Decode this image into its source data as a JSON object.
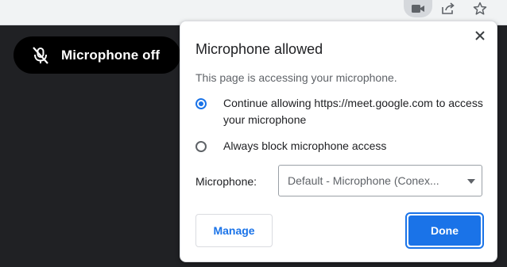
{
  "toolbar": {
    "icons": [
      "video-camera-icon",
      "share-icon",
      "star-icon"
    ]
  },
  "meeting": {
    "mic_status": "Microphone off",
    "mic_icon": "microphone-off-icon"
  },
  "dialog": {
    "title": "Microphone allowed",
    "subtitle": "This page is accessing your microphone.",
    "options": [
      {
        "label": "Continue allowing https://meet.google.com to access your microphone",
        "selected": true
      },
      {
        "label": "Always block microphone access",
        "selected": false
      }
    ],
    "microphone_label": "Microphone:",
    "microphone_value": "Default - Microphone (Conex...",
    "manage_label": "Manage",
    "done_label": "Done"
  },
  "colors": {
    "accent": "#1a73e8",
    "page_background": "#202124",
    "toolbar_background": "#f1f3f4"
  }
}
